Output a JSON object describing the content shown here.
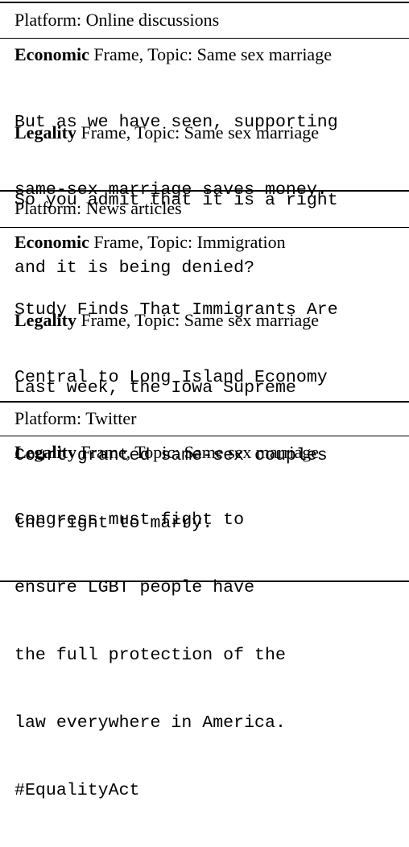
{
  "sections": [
    {
      "platform": "Platform: Online discussions",
      "examples": [
        {
          "frame": "Economic",
          "rest": " Frame, Topic: Same sex marriage",
          "lines": [
            "But as we have seen, supporting",
            "same-sex marriage saves money."
          ]
        },
        {
          "frame": "Legality",
          "rest": " Frame, Topic: Same sex marriage",
          "lines": [
            "So you admit that it is a right",
            "and it is being denied?"
          ]
        }
      ]
    },
    {
      "platform": "Platform: News articles",
      "examples": [
        {
          "frame": "Economic",
          "rest": " Frame, Topic: Immigration",
          "lines": [
            "Study Finds That Immigrants Are",
            "Central to Long Island Economy"
          ]
        },
        {
          "frame": "Legality",
          "rest": " Frame, Topic: Same sex marriage",
          "lines": [
            "Last week, the Iowa Supreme",
            "Court granted same-sex couples",
            "the right to marry."
          ]
        }
      ]
    },
    {
      "platform": "Platform: Twitter",
      "examples": [
        {
          "frame": "Legality",
          "rest": " Frame, Topic: Same sex marriage",
          "lines": [
            "Congress must fight to",
            "ensure LGBT people have",
            "the full protection of the",
            "law everywhere in America.",
            "#EqualityAct"
          ]
        }
      ]
    }
  ]
}
